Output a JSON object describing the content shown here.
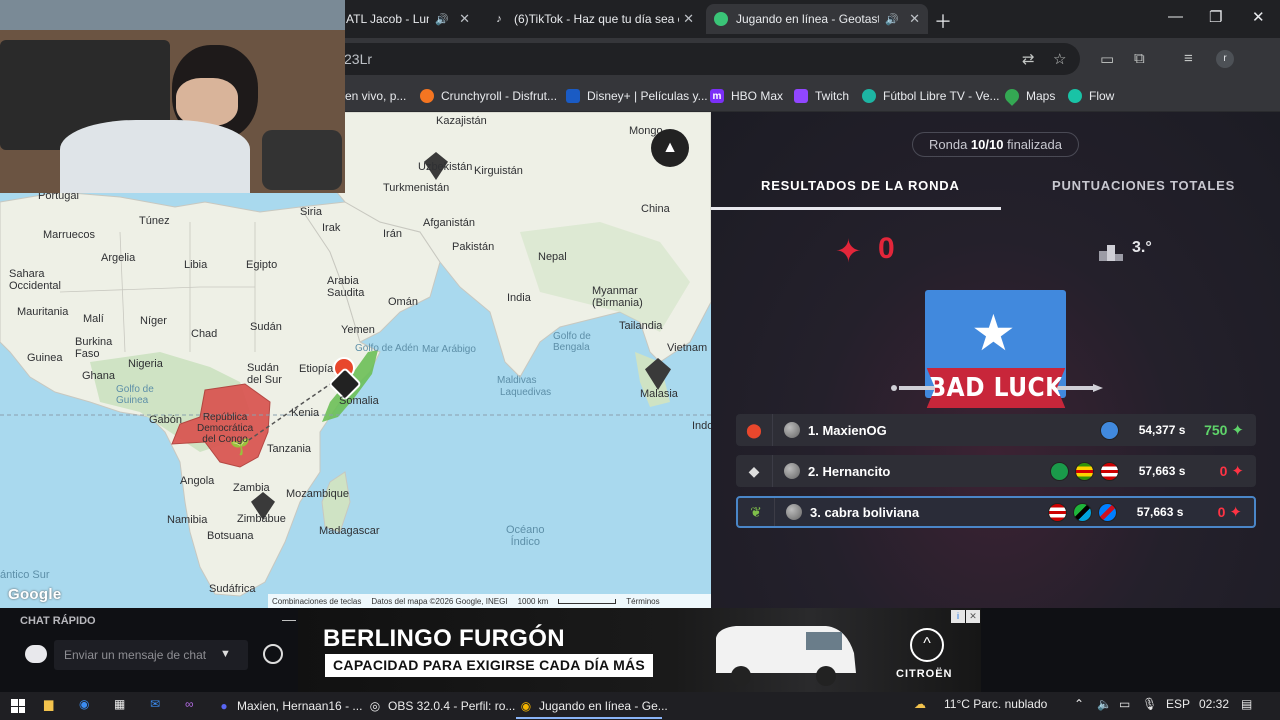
{
  "browser": {
    "tabs": [
      {
        "title": "ATL Jacob - Lun",
        "audio": true
      },
      {
        "title": "(6)TikTok - Haz que tu día sea e",
        "audio": true
      },
      {
        "title": "Jugando en línea - Geotasti",
        "audio": true,
        "active": true
      }
    ],
    "address": "23Lr",
    "bookmarks": [
      {
        "label": "en vivo, p...",
        "color": "#ff4500"
      },
      {
        "label": "Crunchyroll - Disfrut...",
        "color": "#f47521"
      },
      {
        "label": "Disney+ | Películas y...",
        "color": "#1a5bc4"
      },
      {
        "label": "HBO Max",
        "color": "#7b2ff7",
        "glyph": "m"
      },
      {
        "label": "Twitch",
        "color": "#9146ff"
      },
      {
        "label": "Fútbol Libre TV - Ve...",
        "color": "#1db5a3"
      },
      {
        "label": "Maps",
        "color": "#34a853"
      },
      {
        "label": "Flow",
        "color": "#19c3a6"
      }
    ]
  },
  "map": {
    "labels": {
      "kazajistan": "Kazajistán",
      "mongolia": "Mongo",
      "uzbekistan": "Uzbekistán",
      "kirguistan": "Kirguistán",
      "turkmenistan": "Turkmenistán",
      "portugal": "Portugal",
      "tunez": "Túnez",
      "siria": "Siria",
      "irak": "Irak",
      "iran": "Irán",
      "afganistan": "Afganistán",
      "china": "China",
      "marruecos": "Marruecos",
      "argelia": "Argelia",
      "libia": "Libia",
      "egipto": "Egipto",
      "pakistan": "Pakistán",
      "nepal": "Nepal",
      "sahara": "Sahara\nOccidental",
      "arabia": "Arabia\nSaudita",
      "oman": "Omán",
      "india": "India",
      "myanmar": "Myanmar\n(Birmania)",
      "mauritania": "Mauritania",
      "mali": "Malí",
      "niger": "Níger",
      "chad": "Chad",
      "sudan": "Sudán",
      "yemen": "Yemen",
      "golfo_bengala": "Golfo de\nBengala",
      "tailandia": "Tailandia",
      "burkina": "Burkina\nFaso",
      "guinea": "Guinea",
      "nigeria": "Nigeria",
      "golfo_aden": "Golfo de Adén",
      "mar_arabigo": "Mar Arábigo",
      "vietnam": "Vietnam",
      "ghana": "Ghana",
      "golfo_guinea": "Golfo de\nGuinea",
      "sudan_sur": "Sudán\ndel Sur",
      "etiopia": "Etiopía",
      "maldivas": "Maldivas",
      "lakshadweep": "Laquedivas",
      "somalia": "Somalia",
      "malasia": "Malasia",
      "gabon": "Gabón",
      "rdc": "República\nDemocrática\ndel Congo",
      "kenia": "Kenia",
      "indo": "Indo",
      "tanzania": "Tanzania",
      "angola": "Angola",
      "zambia": "Zambia",
      "mozambique": "Mozambique",
      "namibia": "Namibia",
      "zimbabue": "Zimbabue",
      "madagascar": "Madagascar",
      "oceano_indico": "Océano\nÍndico",
      "botsuana": "Botsuana",
      "atlantico_sur": "ántico Sur",
      "sudafrica": "Sudáfrica"
    },
    "google": "Google",
    "attribution": {
      "shortcuts": "Combinaciones de teclas",
      "data": "Datos del mapa ©2026 Google, INEGI",
      "scale": "1000 km",
      "terms": "Términos"
    }
  },
  "results": {
    "round_prefix": "Ronda ",
    "round_value": "10/10",
    "round_suffix": " finalizada",
    "tab_round": "RESULTADOS DE LA RONDA",
    "tab_total": "PUNTUACIONES TOTALES",
    "score": "0",
    "rank": "3.°",
    "banner": "BAD LUCK",
    "players": [
      {
        "name": "1. MaxienOG",
        "time": "54,377 s",
        "points": "750",
        "positive": true
      },
      {
        "name": "2. Hernancito",
        "time": "57,663 s",
        "points": "0",
        "positive": false
      },
      {
        "name": "3. cabra boliviana",
        "time": "57,663 s",
        "points": "0",
        "positive": false
      }
    ]
  },
  "chat": {
    "title": "CHAT RÁPIDO",
    "placeholder": "Enviar un mensaje de chat"
  },
  "ad": {
    "title": "BERLINGO FURGÓN",
    "subtitle": "CAPACIDAD PARA EXIGIRSE CADA DÍA MÁS",
    "brand": "CITROËN"
  },
  "taskbar": {
    "apps": [
      {
        "label": "Maxien, Hernaan16 - ..."
      },
      {
        "label": "OBS 32.0.4 - Perfil: ro..."
      },
      {
        "label": "Jugando en línea - Ge..."
      }
    ],
    "weather": "11°C  Parc. nublado",
    "lang": "ESP",
    "time": "02:32"
  },
  "colors": {
    "accent": "#4a86c8",
    "negative": "#e3263a",
    "positive": "#5fd46a",
    "rdc_fill": "#d9534f"
  }
}
